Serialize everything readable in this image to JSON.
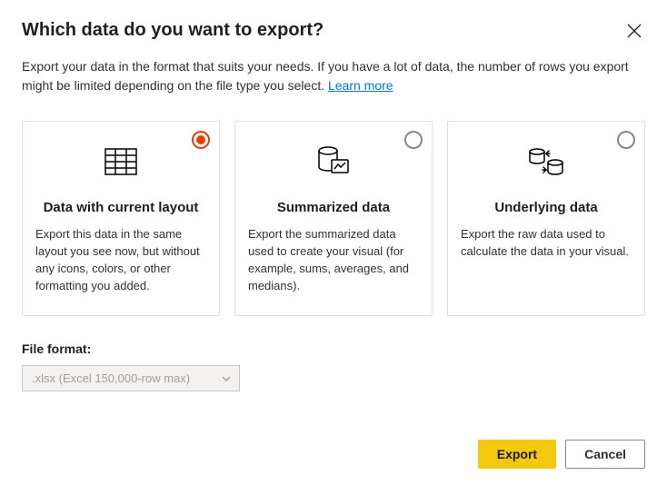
{
  "title": "Which data do you want to export?",
  "subtitle_prefix": "Export your data in the format that suits your needs. If you have a lot of data, the number of rows you export might be limited depending on the file type you select.  ",
  "learn_more": "Learn more",
  "cards": {
    "0": {
      "title": "Data with current layout",
      "desc": "Export this data in the same layout you see now, but without any icons, colors, or other formatting you added."
    },
    "1": {
      "title": "Summarized data",
      "desc": "Export the summarized data used to create your visual (for example, sums, averages, and medians)."
    },
    "2": {
      "title": "Underlying data",
      "desc": "Export the raw data used to calculate the data in your visual."
    }
  },
  "file_format_label": "File format:",
  "file_format_value": ".xlsx (Excel 150,000-row max)",
  "buttons": {
    "export": "Export",
    "cancel": "Cancel"
  }
}
